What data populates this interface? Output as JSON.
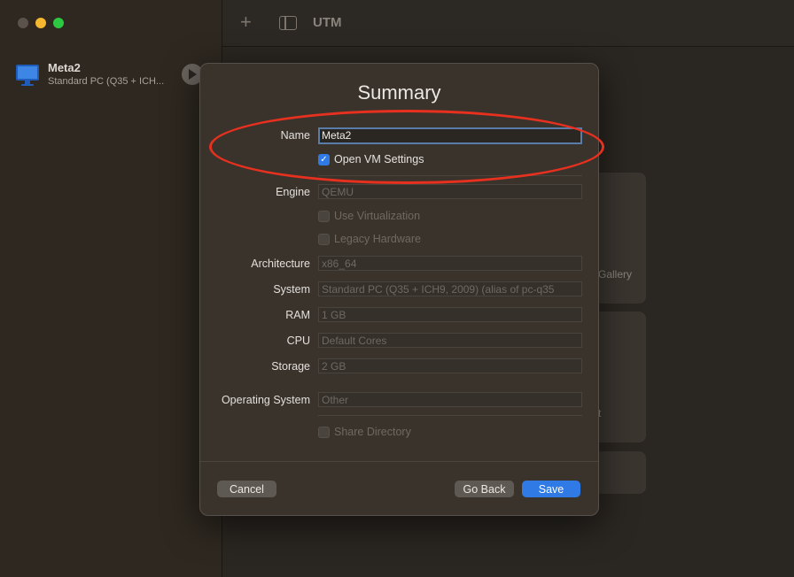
{
  "app": {
    "title": "UTM"
  },
  "sidebar": {
    "vm": {
      "name": "Meta2",
      "subtitle": "Standard PC (Q35 + ICH..."
    }
  },
  "background_cards": {
    "gallery_text": "Gallery",
    "partial_text": "t"
  },
  "dialog": {
    "title": "Summary",
    "fields": {
      "name": {
        "label": "Name",
        "value": "Meta2"
      },
      "open_vm_settings": {
        "label": "Open VM Settings",
        "checked": true
      },
      "engine": {
        "label": "Engine",
        "value": "QEMU"
      },
      "use_virtualization": {
        "label": "Use Virtualization",
        "checked": false
      },
      "legacy_hardware": {
        "label": "Legacy Hardware",
        "checked": false
      },
      "architecture": {
        "label": "Architecture",
        "value": "x86_64"
      },
      "system": {
        "label": "System",
        "value": "Standard PC (Q35 + ICH9, 2009) (alias of pc-q35"
      },
      "ram": {
        "label": "RAM",
        "value": "1 GB"
      },
      "cpu": {
        "label": "CPU",
        "value": "Default Cores"
      },
      "storage": {
        "label": "Storage",
        "value": "2 GB"
      },
      "operating_system": {
        "label": "Operating System",
        "value": "Other"
      },
      "share_directory": {
        "label": "Share Directory",
        "checked": false
      }
    },
    "buttons": {
      "cancel": "Cancel",
      "go_back": "Go Back",
      "save": "Save"
    }
  },
  "colors": {
    "accent": "#2f7ae5",
    "annotation": "#e8301f"
  }
}
